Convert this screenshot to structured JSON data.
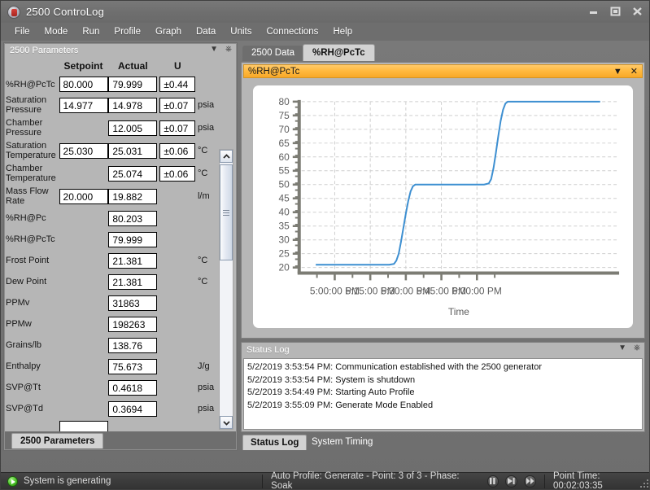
{
  "window": {
    "title": "2500 ControLog",
    "app_icon": "app-logo-icon",
    "minimize_label": "Minimize",
    "maximize_label": "Maximize",
    "close_label": "Close"
  },
  "menu": {
    "items": [
      {
        "label": "File"
      },
      {
        "label": "Mode"
      },
      {
        "label": "Run"
      },
      {
        "label": "Profile"
      },
      {
        "label": "Graph"
      },
      {
        "label": "Data"
      },
      {
        "label": "Units"
      },
      {
        "label": "Connections"
      },
      {
        "label": "Help"
      }
    ]
  },
  "parameters_panel": {
    "caption": "2500 Parameters",
    "collapse_icon": "chevron-down-icon",
    "pin_icon": "pin-icon",
    "headers": {
      "label": "",
      "setpoint": "Setpoint",
      "actual": "Actual",
      "u": "U"
    },
    "rows": [
      {
        "label": "%RH@PcTc",
        "setpoint": "80.000",
        "actual": "79.999",
        "u": "±0.44",
        "unit": ""
      },
      {
        "label": "Saturation Pressure",
        "setpoint": "14.977",
        "actual": "14.978",
        "u": "±0.07",
        "unit": "psia"
      },
      {
        "label": "Chamber Pressure",
        "setpoint": "",
        "actual": "12.005",
        "u": "±0.07",
        "unit": "psia"
      },
      {
        "label": "Saturation Temperature",
        "setpoint": "25.030",
        "actual": "25.031",
        "u": "±0.06",
        "unit": "°C"
      },
      {
        "label": "Chamber Temperature",
        "setpoint": "",
        "actual": "25.074",
        "u": "±0.06",
        "unit": "°C"
      },
      {
        "label": "Mass Flow Rate",
        "setpoint": "20.000",
        "actual": "19.882",
        "u": "",
        "unit": "l/m"
      },
      {
        "label": "%RH@Pc",
        "setpoint": "",
        "actual": "80.203",
        "u": "",
        "unit": ""
      },
      {
        "label": "%RH@PcTc",
        "setpoint": "",
        "actual": "79.999",
        "u": "",
        "unit": ""
      },
      {
        "label": "Frost Point",
        "setpoint": "",
        "actual": "21.381",
        "u": "",
        "unit": "°C"
      },
      {
        "label": "Dew Point",
        "setpoint": "",
        "actual": "21.381",
        "u": "",
        "unit": "°C"
      },
      {
        "label": "PPMv",
        "setpoint": "",
        "actual": "31863",
        "u": "",
        "unit": ""
      },
      {
        "label": "PPMw",
        "setpoint": "",
        "actual": "198263",
        "u": "",
        "unit": ""
      },
      {
        "label": "Grains/lb",
        "setpoint": "",
        "actual": "138.76",
        "u": "",
        "unit": ""
      },
      {
        "label": "Enthalpy",
        "setpoint": "",
        "actual": "75.673",
        "u": "",
        "unit": "J/g"
      },
      {
        "label": "SVP@Tt",
        "setpoint": "",
        "actual": "0.4618",
        "u": "",
        "unit": "psia"
      },
      {
        "label": "SVP@Td",
        "setpoint": "",
        "actual": "0.3694",
        "u": "",
        "unit": "psia"
      }
    ],
    "scrollbar": {
      "up_icon": "chevron-up-icon",
      "down_icon": "chevron-down-icon",
      "grip_icon": "grip-icon"
    },
    "bottom_tab": "2500 Parameters"
  },
  "tabs": {
    "items": [
      {
        "label": "2500 Data",
        "active": false
      },
      {
        "label": "%RH@PcTc",
        "active": true
      }
    ]
  },
  "graph_panel": {
    "caption": "%RH@PcTc",
    "collapse_icon": "chevron-down-icon",
    "close_icon": "close-icon",
    "accent_color": "#ffb93f",
    "series_color": "#3d8fd1"
  },
  "chart_data": {
    "type": "line",
    "title": "",
    "xlabel": "Time",
    "ylabel": "",
    "ylim": [
      18,
      80
    ],
    "yticks": [
      20,
      25,
      30,
      35,
      40,
      45,
      50,
      55,
      60,
      65,
      70,
      75,
      80
    ],
    "xticks": [
      "5:00:00 PM",
      "5:15:00 PM",
      "5:30:00 PM",
      "5:45:00 PM",
      "6:00:00 PM"
    ],
    "grid": true,
    "legend": "none",
    "series": [
      {
        "name": "%RH@PcTc",
        "color": "#3d8fd1",
        "x_minutes": [
          292,
          297,
          300,
          305,
          310,
          315,
          320,
          323,
          325,
          326,
          327,
          328,
          329,
          330,
          331,
          332,
          333,
          334,
          335,
          340,
          345,
          350,
          355,
          360,
          363,
          365,
          366,
          367,
          368,
          369,
          370,
          371,
          372,
          373,
          375,
          380,
          385,
          390,
          395,
          400,
          405,
          410,
          412
        ],
        "values": [
          21,
          21,
          21,
          21,
          21,
          21,
          21,
          21,
          21.3,
          22.5,
          25,
          29.5,
          34.5,
          39.5,
          44,
          47.5,
          49.4,
          50,
          50,
          50,
          50,
          50,
          50,
          50,
          50,
          50.4,
          52,
          56,
          61.5,
          67.5,
          73,
          77,
          79.3,
          80,
          80,
          80,
          80,
          80,
          80,
          80,
          80,
          80,
          80
        ]
      }
    ]
  },
  "status_log_panel": {
    "caption": "Status Log",
    "collapse_icon": "chevron-down-icon",
    "pin_icon": "pin-icon",
    "entries": [
      {
        "timestamp": "5/2/2019 3:53:54 PM:",
        "message": "Communication established with the 2500 generator"
      },
      {
        "timestamp": "5/2/2019 3:53:54 PM:",
        "message": "System is shutdown"
      },
      {
        "timestamp": "5/2/2019 3:54:49 PM:",
        "message": "Starting Auto Profile"
      },
      {
        "timestamp": "5/2/2019 3:55:09 PM:",
        "message": "Generate Mode Enabled"
      }
    ],
    "tabs": [
      {
        "label": "Status Log",
        "active": true
      },
      {
        "label": "System Timing",
        "active": false
      }
    ]
  },
  "status_bar": {
    "state_icon": "play-icon",
    "state_text": "System is generating",
    "profile_text": "Auto Profile: Generate - Point: 3 of 3 - Phase: Soak",
    "controls": [
      {
        "name": "pause-button",
        "icon": "pause-icon"
      },
      {
        "name": "skip-next-button",
        "icon": "skip-next-icon"
      },
      {
        "name": "fast-forward-button",
        "icon": "fast-forward-icon"
      }
    ],
    "point_time_text": "Point Time: 00:02:03:35",
    "resize_grip": "resize-grip-icon"
  }
}
